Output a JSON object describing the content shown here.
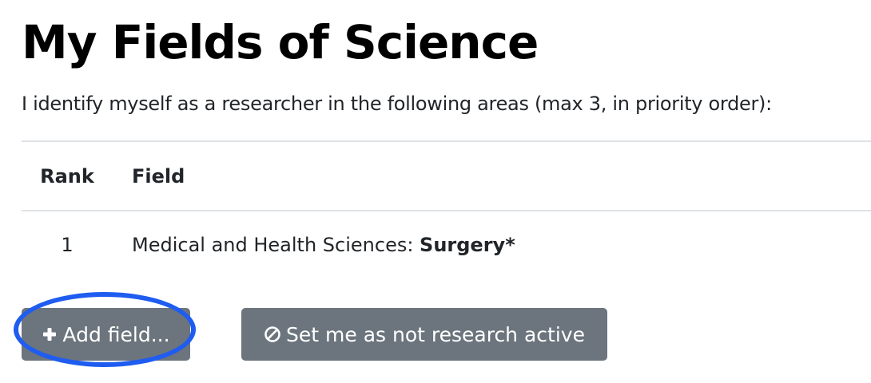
{
  "page": {
    "title": "My Fields of Science",
    "intro": "I identify myself as a researcher in the following areas (max 3, in priority order):"
  },
  "table": {
    "headers": {
      "rank": "Rank",
      "field": "Field"
    },
    "rows": [
      {
        "rank": "1",
        "field_prefix": "Medical and Health Sciences: ",
        "field_name": "Surgery*"
      }
    ]
  },
  "actions": {
    "add_field_label": "Add field...",
    "add_field_icon": "plus-icon",
    "not_active_label": "Set me as not research active",
    "not_active_icon": "ban-icon"
  },
  "colors": {
    "button_bg": "#6c757d",
    "highlight_ring": "#1f5cf0"
  }
}
